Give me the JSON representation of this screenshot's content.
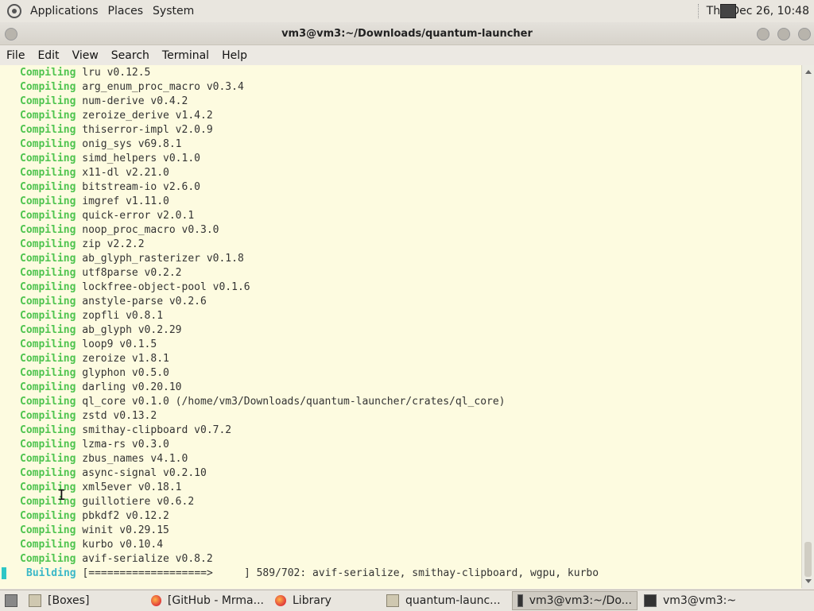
{
  "top_panel": {
    "menus": [
      "Applications",
      "Places",
      "System"
    ],
    "clock": "Thu Dec 26, 10:48"
  },
  "window": {
    "title": "vm3@vm3:~/Downloads/quantum-launcher"
  },
  "menubar": [
    "File",
    "Edit",
    "View",
    "Search",
    "Terminal",
    "Help"
  ],
  "terminal": {
    "keyword": "Compiling",
    "lines": [
      "lru v0.12.5",
      "arg_enum_proc_macro v0.3.4",
      "num-derive v0.4.2",
      "zeroize_derive v1.4.2",
      "thiserror-impl v2.0.9",
      "onig_sys v69.8.1",
      "simd_helpers v0.1.0",
      "x11-dl v2.21.0",
      "bitstream-io v2.6.0",
      "imgref v1.11.0",
      "quick-error v2.0.1",
      "noop_proc_macro v0.3.0",
      "zip v2.2.2",
      "ab_glyph_rasterizer v0.1.8",
      "utf8parse v0.2.2",
      "lockfree-object-pool v0.1.6",
      "anstyle-parse v0.2.6",
      "zopfli v0.8.1",
      "ab_glyph v0.2.29",
      "loop9 v0.1.5",
      "zeroize v1.8.1",
      "glyphon v0.5.0",
      "darling v0.20.10",
      "ql_core v0.1.0 (/home/vm3/Downloads/quantum-launcher/crates/ql_core)",
      "zstd v0.13.2",
      "smithay-clipboard v0.7.2",
      "lzma-rs v0.3.0",
      "zbus_names v4.1.0",
      "async-signal v0.2.10",
      "xml5ever v0.18.1",
      "guillotiere v0.6.2",
      "pbkdf2 v0.12.2",
      "winit v0.29.15",
      "kurbo v0.10.4",
      "avif-serialize v0.8.2"
    ],
    "building_keyword": "Building",
    "building_text": "[===================>     ] 589/702: avif-serialize, smithay-clipboard, wgpu, kurbo",
    "progress": {
      "done": 589,
      "total": 702
    }
  },
  "taskbar": {
    "tasks": [
      {
        "label": "[Boxes]",
        "icon": "folder-icon"
      },
      {
        "label": "[GitHub - Mrma...",
        "icon": "firefox-icon"
      },
      {
        "label": "Library",
        "icon": "firefox-icon"
      },
      {
        "label": "quantum-launc...",
        "icon": "folder-icon"
      },
      {
        "label": "vm3@vm3:~/Do...",
        "icon": "terminal-icon"
      },
      {
        "label": "vm3@vm3:~",
        "icon": "terminal-icon"
      }
    ]
  },
  "colors": {
    "terminal_bg": "#fdfbe0",
    "compiling": "#4fc44f",
    "building": "#3bb8c8"
  }
}
